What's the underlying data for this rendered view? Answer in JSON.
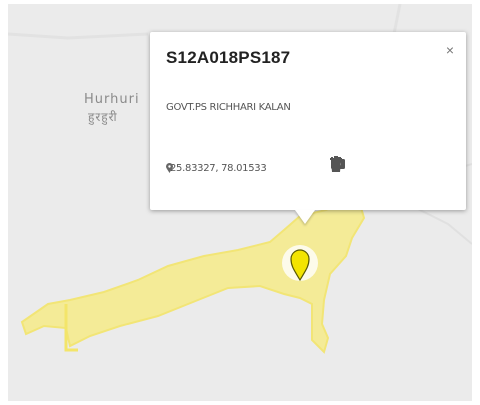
{
  "map": {
    "place_label_en": "Hurhuri",
    "place_label_hi": "हुरहुरी",
    "polygon_fill": "#f5ec8e",
    "polygon_stroke": "#f3e56a",
    "background": "#ebebeb"
  },
  "marker": {
    "color": "#f3e400",
    "icon": "map-pin-icon"
  },
  "popup": {
    "title": "S12A018PS187",
    "close_label": "×",
    "description": "GOVT.PS RICHHARI KALAN",
    "coordinates": "25.83327, 78.01533",
    "actions": [
      {
        "name": "fill-color-button",
        "icon": "paint-bucket-icon"
      },
      {
        "name": "edit-button",
        "icon": "pencil-icon"
      },
      {
        "name": "photo-button",
        "icon": "camera-icon"
      },
      {
        "name": "split-button",
        "icon": "fork-icon"
      },
      {
        "name": "delete-button",
        "icon": "trash-icon"
      }
    ]
  }
}
